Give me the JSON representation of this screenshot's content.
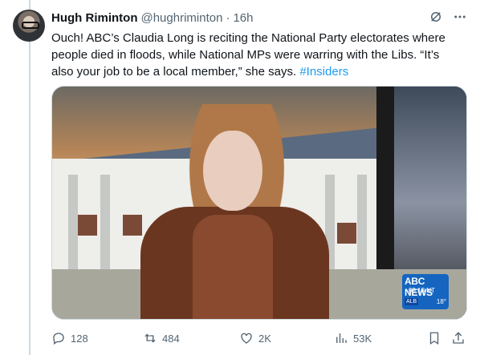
{
  "author": {
    "name": "Hugh Riminton",
    "handle": "@hughriminton",
    "separator": "·",
    "time": "16h"
  },
  "tweet": {
    "text_main": "Ouch! ABC’s Claudia Long is reciting the National Party electorates where people died in floods, while National MPs were warring with the Libs. “It’s also your job to be a local member,” she says. ",
    "hashtag": "#Insiders"
  },
  "media": {
    "badge_logo": "ABC NEWS",
    "badge_time": "09:13 NT",
    "badge_location": "ALB",
    "badge_temp": "18°"
  },
  "actions": {
    "replies": "128",
    "reposts": "484",
    "likes": "2K",
    "views": "53K"
  },
  "icons": [
    "grok-icon",
    "more-icon",
    "reply-icon",
    "repost-icon",
    "like-icon",
    "views-icon",
    "bookmark-icon",
    "share-icon"
  ],
  "colors": {
    "link": "#1d9bf0",
    "muted": "#536471",
    "text": "#0f1419"
  }
}
